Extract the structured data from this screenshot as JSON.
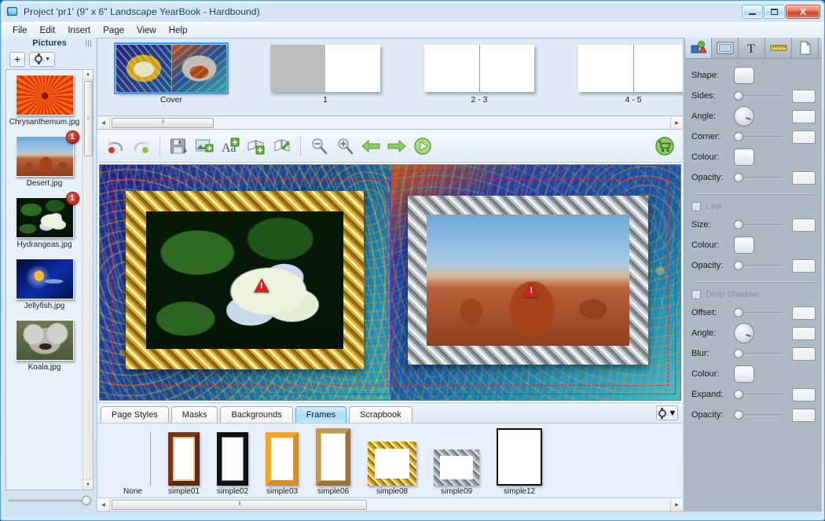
{
  "window": {
    "title": "Project 'pr1' (9\" x 6\" Landscape YearBook - Hardbound)",
    "app_icon": "photobook-app-icon",
    "minimize_label": "Minimize",
    "maximize_label": "Maximize",
    "close_label": "X",
    "accent_color": "#3f9ade",
    "titlebar_color": "#d4e6f7"
  },
  "menu": {
    "items": [
      {
        "label": "File"
      },
      {
        "label": "Edit"
      },
      {
        "label": "Insert"
      },
      {
        "label": "Page"
      },
      {
        "label": "View"
      },
      {
        "label": "Help"
      }
    ]
  },
  "pictures": {
    "title": "Pictures",
    "add_button_label": "+",
    "options_button_label": "",
    "items": [
      {
        "label": "Chrysanthemum.jpg",
        "badge": "",
        "kind": "chrysanthemum"
      },
      {
        "label": "Desert.jpg",
        "badge": "1",
        "kind": "desert"
      },
      {
        "label": "Hydrangeas.jpg",
        "badge": "1",
        "kind": "hydrangeas"
      },
      {
        "label": "Jellyfish.jpg",
        "badge": "",
        "kind": "jellyfish"
      },
      {
        "label": "Koala.jpg",
        "badge": "",
        "kind": "koala"
      }
    ],
    "scroll_up_icon": "▲",
    "scroll_down_icon": "▼",
    "zoom_slider_value": "100"
  },
  "pagestrip": {
    "thumbs": [
      {
        "label": "Cover",
        "selected": true,
        "style": "cover"
      },
      {
        "label": "1",
        "selected": false,
        "style": "gray-white"
      },
      {
        "label": "2 - 3",
        "selected": false,
        "style": "white-white"
      },
      {
        "label": "4 - 5",
        "selected": false,
        "style": "white-white"
      }
    ],
    "scroll_left_icon": "◀",
    "scroll_right_icon": "▶",
    "grip_icon": "⦀"
  },
  "toolbar": {
    "buttons": [
      {
        "name": "undo-button",
        "label": "Undo"
      },
      {
        "name": "redo-button",
        "label": "Redo"
      },
      {
        "name": "save-button",
        "label": "Save"
      },
      {
        "name": "add-picture-button",
        "label": "Add Picture"
      },
      {
        "name": "add-text-button",
        "label": "Add Text"
      },
      {
        "name": "add-page-button",
        "label": "Add Page"
      },
      {
        "name": "page-layout-button",
        "label": "Page Layout"
      },
      {
        "name": "zoom-out-button",
        "label": "Zoom Out"
      },
      {
        "name": "zoom-in-button",
        "label": "Zoom In"
      },
      {
        "name": "previous-page-button",
        "label": "Previous Page"
      },
      {
        "name": "next-page-button",
        "label": "Next Page"
      },
      {
        "name": "preview-button",
        "label": "Preview"
      },
      {
        "name": "buy-cart-button",
        "label": "Order"
      }
    ]
  },
  "canvas": {
    "left_page": {
      "frame_style": "ornate-gold",
      "photo": "Hydrangeas.jpg",
      "warning": "!"
    },
    "right_page": {
      "frame_style": "ornate-silver",
      "photo": "Desert.jpg",
      "warning": "!"
    }
  },
  "gallery": {
    "tabs": [
      {
        "label": "Page Styles",
        "active": false
      },
      {
        "label": "Masks",
        "active": false
      },
      {
        "label": "Backgrounds",
        "active": false
      },
      {
        "label": "Frames",
        "active": true
      },
      {
        "label": "Scrapbook",
        "active": false
      }
    ],
    "options_button_label": "",
    "items": [
      {
        "label": "None",
        "style": "none"
      },
      {
        "label": "simple01",
        "style": "s01"
      },
      {
        "label": "simple02",
        "style": "s02"
      },
      {
        "label": "simple03",
        "style": "s03"
      },
      {
        "label": "simple06",
        "style": "s06"
      },
      {
        "label": "simple08",
        "style": "s08"
      },
      {
        "label": "simple09",
        "style": "s09"
      },
      {
        "label": "simple12",
        "style": "s12"
      }
    ],
    "scroll_left_icon": "◀",
    "scroll_right_icon": "▶"
  },
  "properties": {
    "tabs": [
      {
        "name": "shapes-tab",
        "icon": "shapes-icon",
        "active": true
      },
      {
        "name": "frame-tab",
        "icon": "frame-icon",
        "active": false
      },
      {
        "name": "text-tab",
        "icon": "text-icon",
        "active": false
      },
      {
        "name": "ruler-tab",
        "icon": "ruler-icon",
        "active": false
      },
      {
        "name": "page-tab",
        "icon": "page-icon",
        "active": false
      }
    ],
    "shape_section": [
      {
        "label": "Shape:",
        "control": "swatch",
        "value": ""
      },
      {
        "label": "Sides:",
        "control": "slider",
        "value": ""
      },
      {
        "label": "Angle:",
        "control": "dial",
        "value": ""
      },
      {
        "label": "Corner:",
        "control": "slider",
        "value": ""
      },
      {
        "label": "Colour:",
        "control": "swatch",
        "value": ""
      },
      {
        "label": "Opacity:",
        "control": "slider",
        "value": ""
      }
    ],
    "line_section": {
      "checkbox_label": "Line",
      "checked": false,
      "rows": [
        {
          "label": "Size:",
          "control": "slider",
          "value": ""
        },
        {
          "label": "Colour:",
          "control": "swatch",
          "value": ""
        },
        {
          "label": "Opacity:",
          "control": "slider",
          "value": ""
        }
      ]
    },
    "shadow_section": {
      "checkbox_label": "Drop Shadow",
      "checked": false,
      "rows": [
        {
          "label": "Offset:",
          "control": "slider",
          "value": ""
        },
        {
          "label": "Angle:",
          "control": "dial",
          "value": ""
        },
        {
          "label": "Blur:",
          "control": "slider",
          "value": ""
        },
        {
          "label": "Colour:",
          "control": "swatch",
          "value": ""
        },
        {
          "label": "Expand:",
          "control": "slider",
          "value": ""
        },
        {
          "label": "Opacity:",
          "control": "slider",
          "value": ""
        }
      ]
    }
  }
}
